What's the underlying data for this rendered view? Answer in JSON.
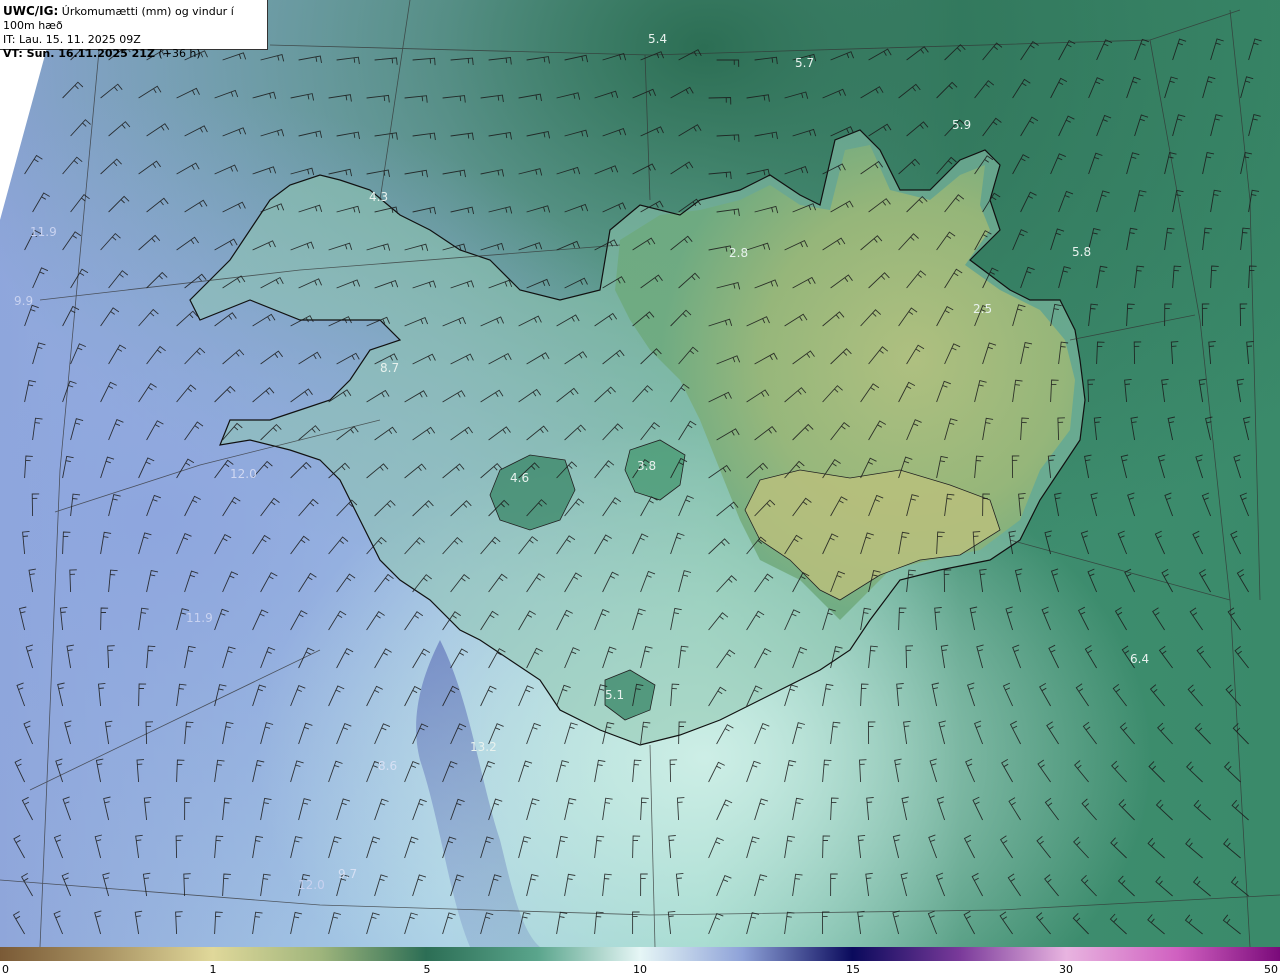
{
  "header": {
    "model": "UWC/IG:",
    "description": " Úrkomumætti (mm) og vindur í 100m hæð",
    "it_line": "IT: Lau. 15. 11. 2025 09Z",
    "vt_bold": "VT: Sun. 16.11.2025 21Z",
    "vt_rest": " (+36 h)"
  },
  "map_labels": [
    {
      "id": "l1",
      "text": "5.4"
    },
    {
      "id": "l2",
      "text": "5.7"
    },
    {
      "id": "l3",
      "text": "5.9"
    },
    {
      "id": "l4",
      "text": "4.3"
    },
    {
      "id": "l5",
      "text": "11.9"
    },
    {
      "id": "l6",
      "text": "2.8"
    },
    {
      "id": "l7",
      "text": "5.8"
    },
    {
      "id": "l8",
      "text": "2.5"
    },
    {
      "id": "l9",
      "text": "8.7"
    },
    {
      "id": "l10",
      "text": "3.8"
    },
    {
      "id": "l11",
      "text": "4.6"
    },
    {
      "id": "l12",
      "text": "12.0"
    },
    {
      "id": "l13",
      "text": "11.9"
    },
    {
      "id": "l14",
      "text": "6.4"
    },
    {
      "id": "l15",
      "text": "5.1"
    },
    {
      "id": "l16",
      "text": "13.2"
    },
    {
      "id": "l17",
      "text": "8.6"
    },
    {
      "id": "l18",
      "text": "12.0"
    },
    {
      "id": "l19",
      "text": "9.7"
    },
    {
      "id": "l20",
      "text": "9.9"
    }
  ],
  "colorbar": {
    "ticks": [
      "0",
      "1",
      "5",
      "10",
      "15",
      "30",
      "50"
    ]
  },
  "colors": {
    "dry": "#b6a66a",
    "land_dry": "#b3bd7a",
    "mid_green": "#4f9a7a",
    "dark_green": "#2f7058",
    "light_cyan": "#c9eee6",
    "blue": "#7b8fd1",
    "navy": "#131a6e",
    "purple": "#a01a9a"
  }
}
